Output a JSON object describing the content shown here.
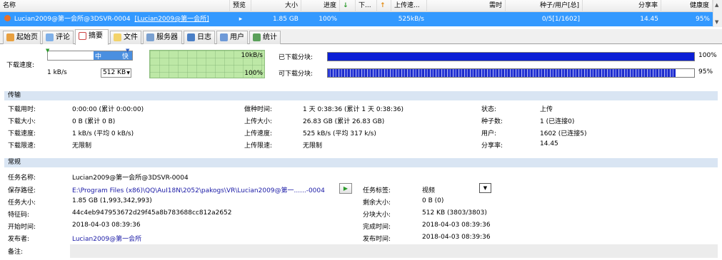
{
  "header": {
    "columns": [
      "名称",
      "预览",
      "大小",
      "进度",
      "↓",
      "下...",
      "↑",
      "上传速...",
      "需时",
      "种子/用户[总]",
      "分享率",
      "健康度"
    ]
  },
  "row": {
    "name": "Lucian2009@第一会所@3DSVR-0004",
    "name_link": "[Lucian2009@第一会所]",
    "size": "1.85 GB",
    "progress": "100%",
    "upload_speed": "525kB/s",
    "seeds_peers": "0/5[1/1602]",
    "share_ratio": "14.45",
    "health": "95%"
  },
  "tabs": [
    {
      "label": "起始页",
      "icon": "home-icon"
    },
    {
      "label": "评论",
      "icon": "comment-icon"
    },
    {
      "label": "摘要",
      "icon": "checklist-icon"
    },
    {
      "label": "文件",
      "icon": "file-icon"
    },
    {
      "label": "服务器",
      "icon": "server-icon"
    },
    {
      "label": "日志",
      "icon": "log-icon"
    },
    {
      "label": "用户",
      "icon": "user-icon"
    },
    {
      "label": "统计",
      "icon": "stats-icon"
    }
  ],
  "speed": {
    "label": "下载速度:",
    "min_label": "1 kB/s",
    "combo_value": "512 KB",
    "slider_mid": "中",
    "slider_fast": "快",
    "graph_top": "10kB/s",
    "graph_bottom": "100%"
  },
  "blocks": {
    "downloaded_label": "已下载分块:",
    "downloaded_pct": "100%",
    "downloaded_value": 1.0,
    "available_label": "可下载分块:",
    "available_pct": "95%",
    "available_value": 0.95
  },
  "transfer": {
    "title": "传输",
    "rows": [
      [
        "下载用时:",
        "0:00:00 (累计 0:00:00)",
        "做种时间:",
        "1 天 0:38:36 (累计 1 天 0:38:36)",
        "状态:",
        "上传"
      ],
      [
        "下载大小:",
        "0 B (累计 0 B)",
        "上传大小:",
        "26.83 GB (累计 26.83 GB)",
        "种子数:",
        "1 (已连接0)"
      ],
      [
        "下载速度:",
        "1 kB/s (平均 0 kB/s)",
        "上传速度:",
        "525 kB/s (平均 317 k/s)",
        "用户:",
        "1602 (已连接5)"
      ],
      [
        "下载限速:",
        "无限制",
        "上传限速:",
        "无限制",
        "分享率:",
        "14.45"
      ]
    ]
  },
  "general": {
    "title": "常规",
    "task_name_label": "任务名称:",
    "task_name": "Lucian2009@第一会所@3DSVR-0004",
    "save_path_label": "保存路径:",
    "save_path": "E:\\Program Files (x86)\\QQ\\AuI18N\\2052\\pakogs\\VR\\Lucian2009@第一......-0004",
    "task_tag_label": "任务标签:",
    "task_tag": "视频",
    "task_size_label": "任务大小:",
    "task_size": "1.85 GB (1,993,342,993)",
    "remaining_label": "剩余大小:",
    "remaining": "0 B (0)",
    "hash_label": "特征码:",
    "hash": "44c4eb947953672d29f45a8b783688cc812a2652",
    "block_size_label": "分块大小:",
    "block_size": "512 KB (3803/3803)",
    "start_label": "开始时间:",
    "start": "2018-04-03 08:39:36",
    "complete_label": "完成时间:",
    "complete": "2018-04-03 08:39:36",
    "publisher_label": "发布者:",
    "publisher": "Lucian2009@第一会所",
    "publish_time_label": "发布时间:",
    "publish_time": "2018-04-03 08:39:36",
    "note_label": "备注:"
  },
  "colors": {
    "selection": "#3399ff",
    "section": "#d9e5f3",
    "graph": "#bde8a6",
    "bar": "#0b1fd6"
  }
}
